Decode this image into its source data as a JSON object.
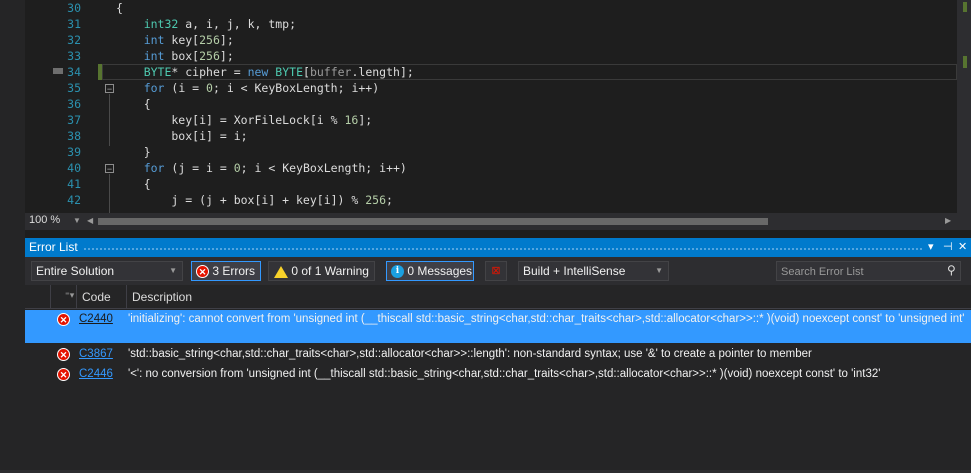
{
  "editor": {
    "zoom": "100 %",
    "lines": [
      {
        "n": "30",
        "code": "{"
      },
      {
        "n": "31",
        "code": "    int32 a, i, j, k, tmp;"
      },
      {
        "n": "32",
        "code": "    int key[256];"
      },
      {
        "n": "33",
        "code": "    int box[256];"
      },
      {
        "n": "34",
        "code": "    BYTE* cipher = new BYTE[buffer.length];"
      },
      {
        "n": "35",
        "code": "    for (i = 0; i < KeyBoxLength; i++)"
      },
      {
        "n": "36",
        "code": "    {"
      },
      {
        "n": "37",
        "code": "        key[i] = XorFileLock[i % 16];"
      },
      {
        "n": "38",
        "code": "        box[i] = i;"
      },
      {
        "n": "39",
        "code": "    }"
      },
      {
        "n": "40",
        "code": "    for (j = i = 0; i < KeyBoxLength; i++)"
      },
      {
        "n": "41",
        "code": "    {"
      },
      {
        "n": "42",
        "code": "        j = (j + box[i] + key[i]) % 256;"
      }
    ]
  },
  "error_list": {
    "title": "Error List",
    "scope": "Entire Solution",
    "errors_btn": "3 Errors",
    "warnings_btn": "0 of 1 Warning",
    "messages_btn": "0 Messages",
    "build_filter": "Build + IntelliSense",
    "search_placeholder": "Search Error List",
    "columns": {
      "code": "Code",
      "description": "Description"
    },
    "rows": [
      {
        "code": "C2440",
        "description": "'initializing': cannot convert from 'unsigned int (__thiscall std::basic_string<char,std::char_traits<char>,std::allocator<char>>::* )(void) noexcept const' to 'unsigned int'"
      },
      {
        "code": "C3867",
        "description": "'std::basic_string<char,std::char_traits<char>,std::allocator<char>>::length': non-standard syntax; use '&' to create a pointer to member"
      },
      {
        "code": "C2446",
        "description": "'<': no conversion from 'unsigned int (__thiscall std::basic_string<char,std::char_traits<char>,std::allocator<char>>::* )(void) noexcept const' to 'int32'"
      }
    ]
  },
  "colors": {
    "accent": "#007acc",
    "selection": "#3399ff",
    "error": "#e51400",
    "warning": "#f8d22a"
  }
}
